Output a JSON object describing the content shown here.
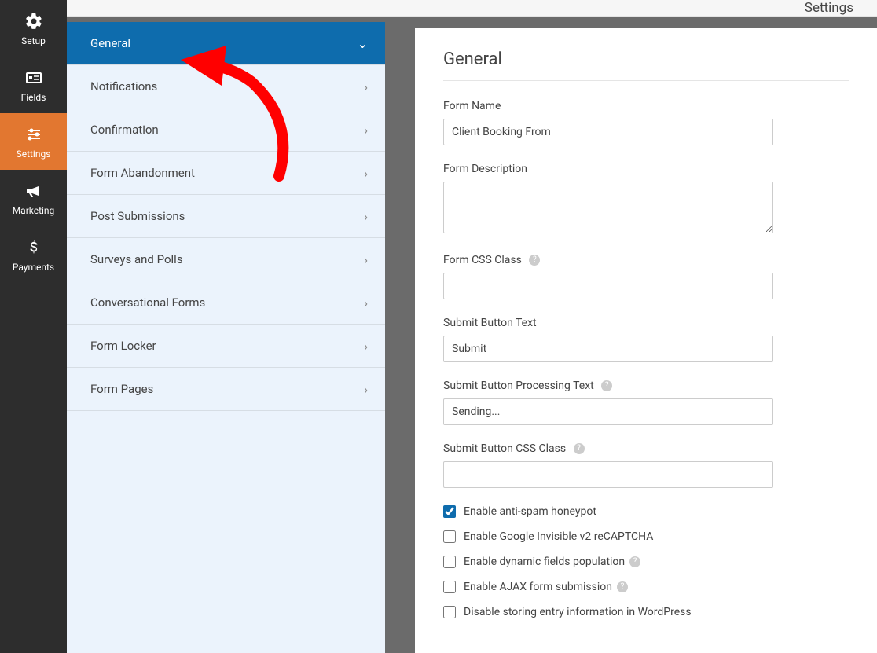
{
  "header": {
    "title": "Settings"
  },
  "left_rail": {
    "items": [
      {
        "label": "Setup"
      },
      {
        "label": "Fields"
      },
      {
        "label": "Settings"
      },
      {
        "label": "Marketing"
      },
      {
        "label": "Payments"
      }
    ],
    "active_index": 2
  },
  "sub_panel": {
    "items": [
      {
        "label": "General"
      },
      {
        "label": "Notifications"
      },
      {
        "label": "Confirmation"
      },
      {
        "label": "Form Abandonment"
      },
      {
        "label": "Post Submissions"
      },
      {
        "label": "Surveys and Polls"
      },
      {
        "label": "Conversational Forms"
      },
      {
        "label": "Form Locker"
      },
      {
        "label": "Form Pages"
      }
    ],
    "active_index": 0
  },
  "main": {
    "heading": "General",
    "fields": {
      "form_name": {
        "label": "Form Name",
        "value": "Client Booking From"
      },
      "form_description": {
        "label": "Form Description",
        "value": ""
      },
      "form_css_class": {
        "label": "Form CSS Class",
        "value": "",
        "help": true
      },
      "submit_button_text": {
        "label": "Submit Button Text",
        "value": "Submit"
      },
      "submit_button_processing": {
        "label": "Submit Button Processing Text",
        "value": "Sending...",
        "help": true
      },
      "submit_button_css": {
        "label": "Submit Button CSS Class",
        "value": "",
        "help": true
      }
    },
    "checkboxes": [
      {
        "label": "Enable anti-spam honeypot",
        "checked": true,
        "help": false
      },
      {
        "label": "Enable Google Invisible v2 reCAPTCHA",
        "checked": false,
        "help": false
      },
      {
        "label": "Enable dynamic fields population",
        "checked": false,
        "help": true
      },
      {
        "label": "Enable AJAX form submission",
        "checked": false,
        "help": true
      },
      {
        "label": "Disable storing entry information in WordPress",
        "checked": false,
        "help": false
      }
    ]
  }
}
